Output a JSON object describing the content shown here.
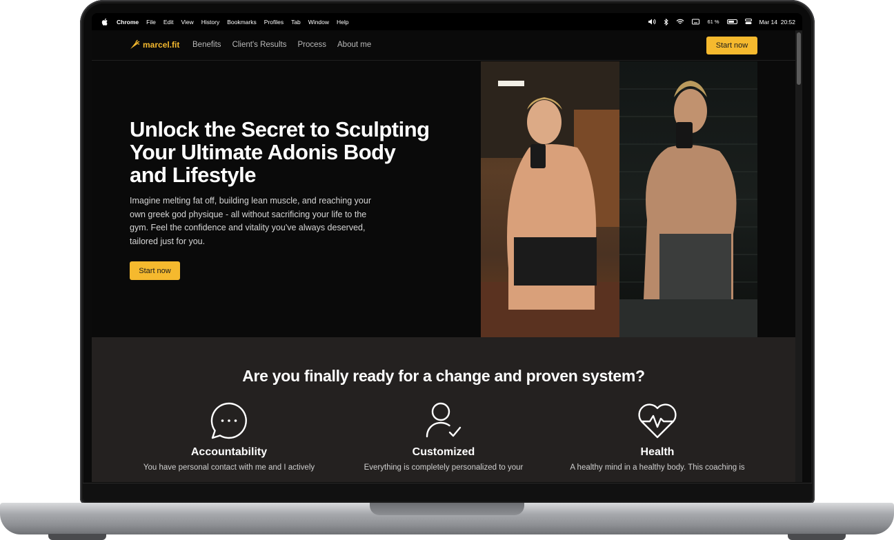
{
  "menubar": {
    "app_name": "Chrome",
    "items": [
      "File",
      "Edit",
      "View",
      "History",
      "Bookmarks",
      "Profiles",
      "Tab",
      "Window",
      "Help"
    ],
    "battery_text": "61 %",
    "datetime": "Mar 14  20:52"
  },
  "nav": {
    "logo_text": "marcel.fit",
    "links": [
      "Benefits",
      "Client's Results",
      "Process",
      "About me"
    ],
    "cta_label": "Start now"
  },
  "hero": {
    "title": "Unlock the Secret to Sculpting Your Ultimate Adonis Body and Lifestyle",
    "subtitle": "Imagine melting fat off, building lean muscle, and reaching your own greek god physique - all without sacrificing your life to the gym. Feel the confidence and vitality you've always deserved, tailored just for you.",
    "cta_label": "Start now"
  },
  "section2": {
    "heading": "Are you finally ready for a change and proven system?",
    "features": [
      {
        "icon": "chat-bubble-icon",
        "title": "Accountability",
        "desc": "You have personal contact with me and I actively"
      },
      {
        "icon": "user-check-icon",
        "title": "Customized",
        "desc": "Everything is completely personalized to your"
      },
      {
        "icon": "heart-pulse-icon",
        "title": "Health",
        "desc": "A healthy mind in a healthy body. This coaching is"
      }
    ]
  },
  "colors": {
    "accent": "#f5b92e",
    "hero_bg": "#0a0a0a",
    "section_bg": "#242120"
  }
}
